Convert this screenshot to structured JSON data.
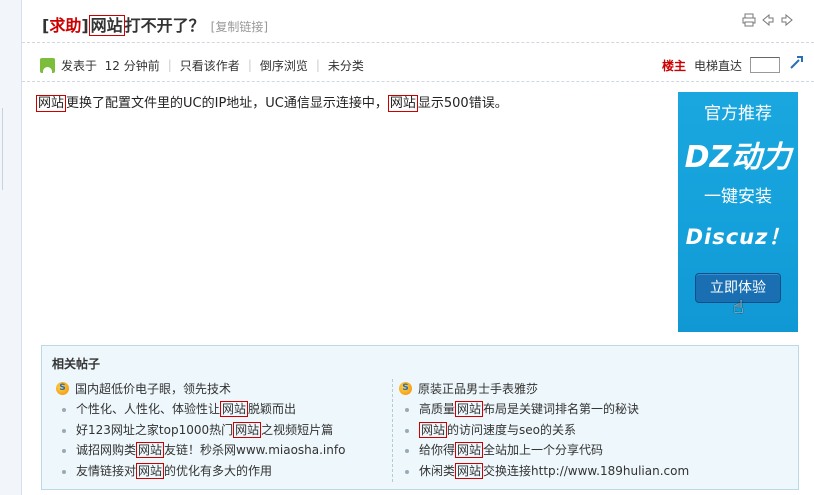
{
  "post": {
    "title_open": "[",
    "title_tag": "求助",
    "title_close": "]",
    "title_kw": "网站",
    "title_rest": "打不开了？",
    "copy_link": "[复制链接]"
  },
  "meta": {
    "posted_label": "发表于",
    "posted_time": "12 分钟前",
    "only_author": "只看该作者",
    "reverse": "倒序浏览",
    "category": "未分类",
    "owner_label": "楼主",
    "elevator_label": "电梯直达"
  },
  "content": {
    "kw1": "网站",
    "text1": "更换了配置文件里的UC的IP地址，UC通信显示连接中，",
    "kw2": "网站",
    "text2": "显示500错误。"
  },
  "ad": {
    "top": "官方推荐",
    "brand": "DZ动力",
    "sub": "一键安装",
    "discuz": "Discuz！",
    "button": "立即体验"
  },
  "related": {
    "title": "相关帖子",
    "left_head": "国内超低价电子眼，领先技术",
    "right_head": "原装正品男士手表雅莎",
    "left_items": [
      {
        "a": "个性化、人性化、体验性让",
        "kw": "网站",
        "b": "脱颖而出"
      },
      {
        "a": "好123网址之家top1000热门",
        "kw": "网站",
        "b": "之视频短片篇"
      },
      {
        "a": "诚招网购类",
        "kw": "网站",
        "b": "友链！秒杀网www.miaosha.info"
      },
      {
        "a": "友情链接对",
        "kw": "网站",
        "b": "的优化有多大的作用"
      }
    ],
    "right_items": [
      {
        "a": "高质量",
        "kw": "网站",
        "b": "布局是关键词排名第一的秘诀"
      },
      {
        "a": "",
        "kw": "网站",
        "b": "的访问速度与seo的关系"
      },
      {
        "a": "给你得",
        "kw": "网站",
        "b": "全站加上一个分享代码"
      },
      {
        "a": "休闲类",
        "kw": "网站",
        "b": "交换连接http://www.189hulian.com"
      }
    ]
  }
}
